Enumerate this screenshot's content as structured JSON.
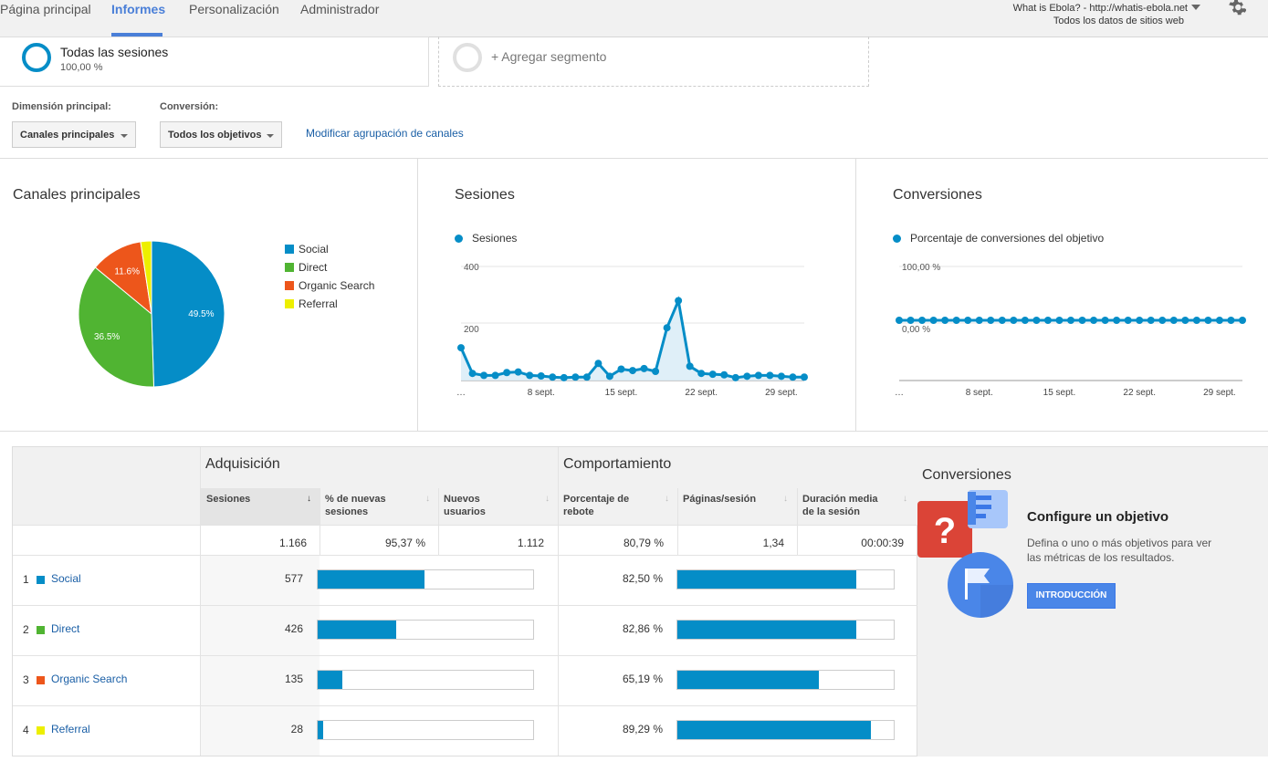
{
  "nav": {
    "tabs": [
      "Página principal",
      "Informes",
      "Personalización",
      "Administrador"
    ],
    "account_line1": "What is Ebola? - http://whatis-ebola.net",
    "account_line2": "Todos los datos de sitios web"
  },
  "segments": {
    "active_title": "Todas las sesiones",
    "active_pct": "100,00 %",
    "add_label": "+ Agregar segmento"
  },
  "controls": {
    "dimension_label": "Dimensión principal:",
    "dimension_value": "Canales principales",
    "conversion_label": "Conversión:",
    "conversion_value": "Todos los objetivos",
    "modify_link": "Modificar agrupación de canales"
  },
  "panels": {
    "pie_title": "Canales principales",
    "sessions_title": "Sesiones",
    "sessions_legend": "Sesiones",
    "conversions_title": "Conversiones",
    "conversions_legend": "Porcentaje de conversiones del objetivo"
  },
  "colors": {
    "social": "#058dc7",
    "direct": "#50b432",
    "organic": "#ed561b",
    "referral": "#edef00",
    "line": "#058dc7"
  },
  "chart_data": [
    {
      "type": "pie",
      "title": "Canales principales",
      "categories": [
        "Social",
        "Direct",
        "Organic Search",
        "Referral"
      ],
      "values": [
        49.5,
        36.5,
        11.6,
        2.4
      ],
      "labels": [
        "49.5%",
        "36.5%",
        "11.6%",
        ""
      ]
    },
    {
      "type": "area",
      "title": "Sesiones",
      "series": [
        {
          "name": "Sesiones",
          "values": [
            115,
            25,
            18,
            18,
            28,
            30,
            18,
            16,
            12,
            10,
            12,
            12,
            60,
            15,
            40,
            35,
            42,
            32,
            185,
            280,
            50,
            25,
            22,
            20,
            10,
            15,
            18,
            18,
            15,
            12,
            12
          ]
        }
      ],
      "x_tick_labels": [
        "…",
        "8 sept.",
        "15 sept.",
        "22 sept.",
        "29 sept."
      ],
      "y_tick_labels": [
        "400",
        "200"
      ],
      "ylim": [
        0,
        400
      ]
    },
    {
      "type": "line",
      "title": "Conversiones",
      "series": [
        {
          "name": "Porcentaje de conversiones del objetivo",
          "values": [
            0,
            0,
            0,
            0,
            0,
            0,
            0,
            0,
            0,
            0,
            0,
            0,
            0,
            0,
            0,
            0,
            0,
            0,
            0,
            0,
            0,
            0,
            0,
            0,
            0,
            0,
            0,
            0,
            0,
            0,
            0
          ]
        }
      ],
      "x_tick_labels": [
        "…",
        "8 sept.",
        "15 sept.",
        "22 sept.",
        "29 sept."
      ],
      "y_tick_labels": [
        "100,00 %",
        "0,00 %"
      ]
    }
  ],
  "table": {
    "groups": [
      "Adquisición",
      "Comportamiento",
      "Conversiones"
    ],
    "columns": [
      "Sesiones",
      "% de nuevas\nsesiones",
      "Nuevos\nusuarios",
      "Porcentaje de\nrebote",
      "Páginas/sesión",
      "Duración media\nde la sesión"
    ],
    "totals": [
      "1.166",
      "95,37 %",
      "1.112",
      "80,79 %",
      "1,34",
      "00:00:39"
    ],
    "rows": [
      {
        "num": "1",
        "name": "Social",
        "sessions": "577",
        "sessions_share": 0.495,
        "bounce": "82,50 %",
        "bounce_rate": 0.825
      },
      {
        "num": "2",
        "name": "Direct",
        "sessions": "426",
        "sessions_share": 0.365,
        "bounce": "82,86 %",
        "bounce_rate": 0.8286
      },
      {
        "num": "3",
        "name": "Organic Search",
        "sessions": "135",
        "sessions_share": 0.116,
        "bounce": "65,19 %",
        "bounce_rate": 0.6519
      },
      {
        "num": "4",
        "name": "Referral",
        "sessions": "28",
        "sessions_share": 0.024,
        "bounce": "89,29 %",
        "bounce_rate": 0.8929
      }
    ]
  },
  "goal": {
    "title": "Configure un objetivo",
    "description": "Defina o uno o más objetivos para ver las métricas de los resultados.",
    "button": "INTRODUCCIÓN"
  }
}
